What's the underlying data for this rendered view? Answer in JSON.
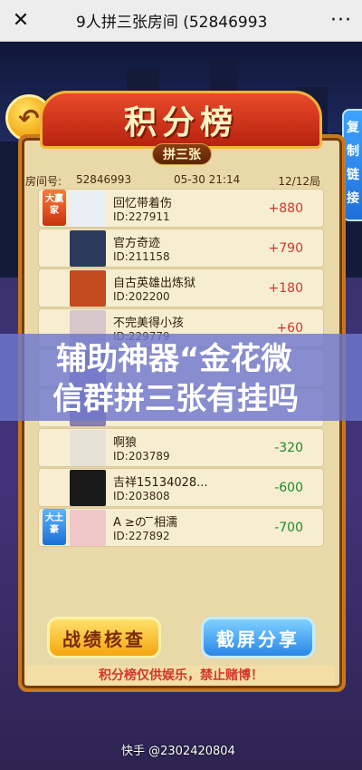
{
  "topbar": {
    "close_icon": "close-icon",
    "title": "9人拼三张房间 (52846993",
    "more_icon": "more-dots-icon",
    "more_glyph": "···"
  },
  "side": {
    "back_icon": "back-arrow-icon",
    "tab_label": "复制链接"
  },
  "board": {
    "title": "积分榜",
    "game_tag": "拼三张",
    "room_label": "房间号:",
    "room_number": "52846993",
    "datetime": "05-30 21:14",
    "round": "12/12局"
  },
  "players": [
    {
      "name": "回忆带着伤",
      "id": "ID:227911",
      "score": "+880",
      "badge": "大赢家",
      "badge_type": "winner",
      "color": "#e9eef5"
    },
    {
      "name": "官方奇迹",
      "id": "ID:211158",
      "score": "+790",
      "color": "#2b3a5a"
    },
    {
      "name": "自古英雄出炼狱",
      "id": "ID:202200",
      "score": "+180",
      "color": "#c24a1e"
    },
    {
      "name": "不完美得小孩",
      "id": "ID:229779",
      "score": "+60",
      "color": "#d8c7c9"
    },
    {
      "name": "",
      "id": "",
      "score": "",
      "color": "#9a8fb8"
    },
    {
      "name": "",
      "id": "",
      "score": "",
      "color": "#8a7fa8"
    },
    {
      "name": "啊狼",
      "id": "ID:203789",
      "score": "-320",
      "color": "#e8e2d6"
    },
    {
      "name": "吉祥15134028...",
      "id": "ID:203808",
      "score": "-600",
      "color": "#1a1a1a"
    },
    {
      "name": "A ≥の ̄ ̄相濡",
      "id": "ID:227892",
      "score": "-700",
      "badge": "大土豪",
      "badge_type": "loser",
      "color": "#f0c8c8"
    }
  ],
  "overlay": {
    "line1": "辅助神器“金花微",
    "line2": "信群拼三张有挂吗"
  },
  "buttons": {
    "record": "战绩核查",
    "share": "截屏分享"
  },
  "notice": "积分榜仅供娱乐，禁止赌博！",
  "watermark": "快手 @2302420804",
  "colors": {
    "accent_red": "#d5352a",
    "accent_green": "#1c8a2a",
    "board_bg": "#e9d9a9"
  }
}
